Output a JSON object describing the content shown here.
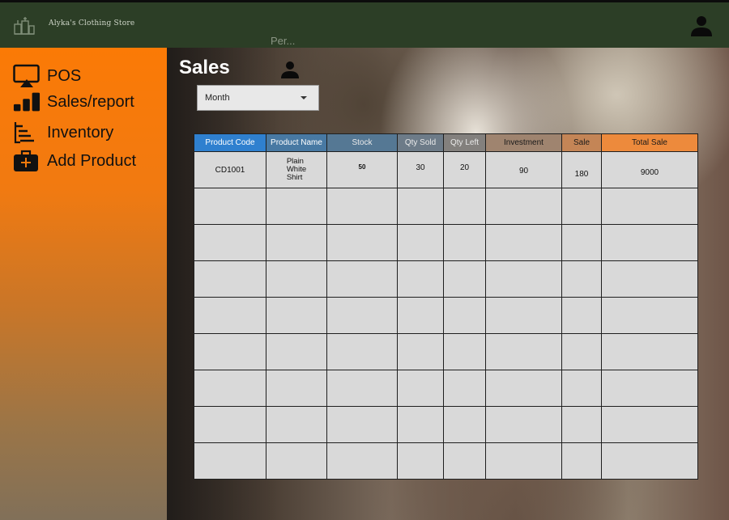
{
  "header": {
    "store_name": "Alyka's Clothing Store",
    "search_placeholder": "Per..."
  },
  "sidebar": {
    "items": [
      {
        "label": "POS",
        "icon": "monitor-cast-icon"
      },
      {
        "label": "Sales/report",
        "icon": "bar-chart-icon"
      },
      {
        "label": "Inventory",
        "icon": "list-tree-icon"
      },
      {
        "label": "Add Product",
        "icon": "medical-bag-icon"
      }
    ]
  },
  "main": {
    "title": "Sales",
    "period_select": "Month"
  },
  "colors": {
    "header_bg": "#2c3e26",
    "sidebar_top": "#fb7a06",
    "sidebar_bottom": "#817059",
    "col_product_code": "#2f80cf",
    "col_total_sale": "#ed8a3c"
  },
  "table": {
    "columns": [
      {
        "label": "Product Code",
        "color": "#2f80cf"
      },
      {
        "label": "Product Name",
        "color": "#4879a3"
      },
      {
        "label": "Stock",
        "color": "#557894"
      },
      {
        "label": "Qty Sold",
        "color": "#6d7b88"
      },
      {
        "label": "Qty Left",
        "color": "#83807d"
      },
      {
        "label": "Investment",
        "color": "#9f846f"
      },
      {
        "label": "Sale",
        "color": "#c48556"
      },
      {
        "label": "Total Sale",
        "color": "#ed8a3c"
      }
    ],
    "rows": [
      {
        "code": "CD1001",
        "name": "Plain\nWhite\nShirt",
        "stock": "50",
        "qty_sold": "30",
        "qty_left": "20",
        "investment": "90",
        "sale": "180",
        "total": "9000"
      }
    ],
    "empty_rows": 8
  }
}
